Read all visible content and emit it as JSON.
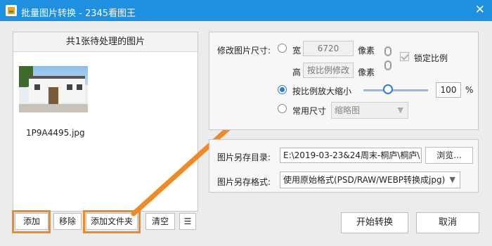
{
  "window": {
    "title": "批量图片转换 - 2345看图王",
    "close_glyph": "✕"
  },
  "left_panel": {
    "header": "共1张待处理的图片",
    "files": [
      {
        "name": "1P9A4495.jpg"
      }
    ],
    "buttons": {
      "add": "添加",
      "remove": "移除",
      "add_folder": "添加文件夹",
      "clear": "清空",
      "list_view_glyph": "☰"
    }
  },
  "resize": {
    "label": "修改图片尺寸:",
    "width_label": "宽",
    "width_value": "6720",
    "width_unit": "像素",
    "height_label": "高",
    "height_value": "按比例修改",
    "height_unit": "像素",
    "lock_ratio_label": "锁定比例",
    "scale_label": "按比例放大缩小",
    "scale_value": "100",
    "scale_unit": "%",
    "common_size_label": "常用尺寸",
    "common_size_value": "缩略图",
    "selected_option": "scale"
  },
  "output": {
    "dir_label": "图片另存目录:",
    "dir_value": "E:\\2019-03-23&24周末-桐庐\\桐庐\\",
    "browse_label": "浏览...",
    "format_label": "图片另存格式:",
    "format_value": "使用原始格式(PSD/RAW/WEBP转换成jpg)"
  },
  "actions": {
    "start": "开始转换",
    "cancel": "取消"
  },
  "colors": {
    "titlebar": "#1f8fe0",
    "highlight": "#f08a24",
    "accent": "#2b7cd3"
  },
  "icons": {
    "app": "image-icon",
    "close": "close-icon",
    "list": "list-view-icon",
    "dropdown": "chevron-down-icon",
    "link": "chain-link-icon"
  }
}
